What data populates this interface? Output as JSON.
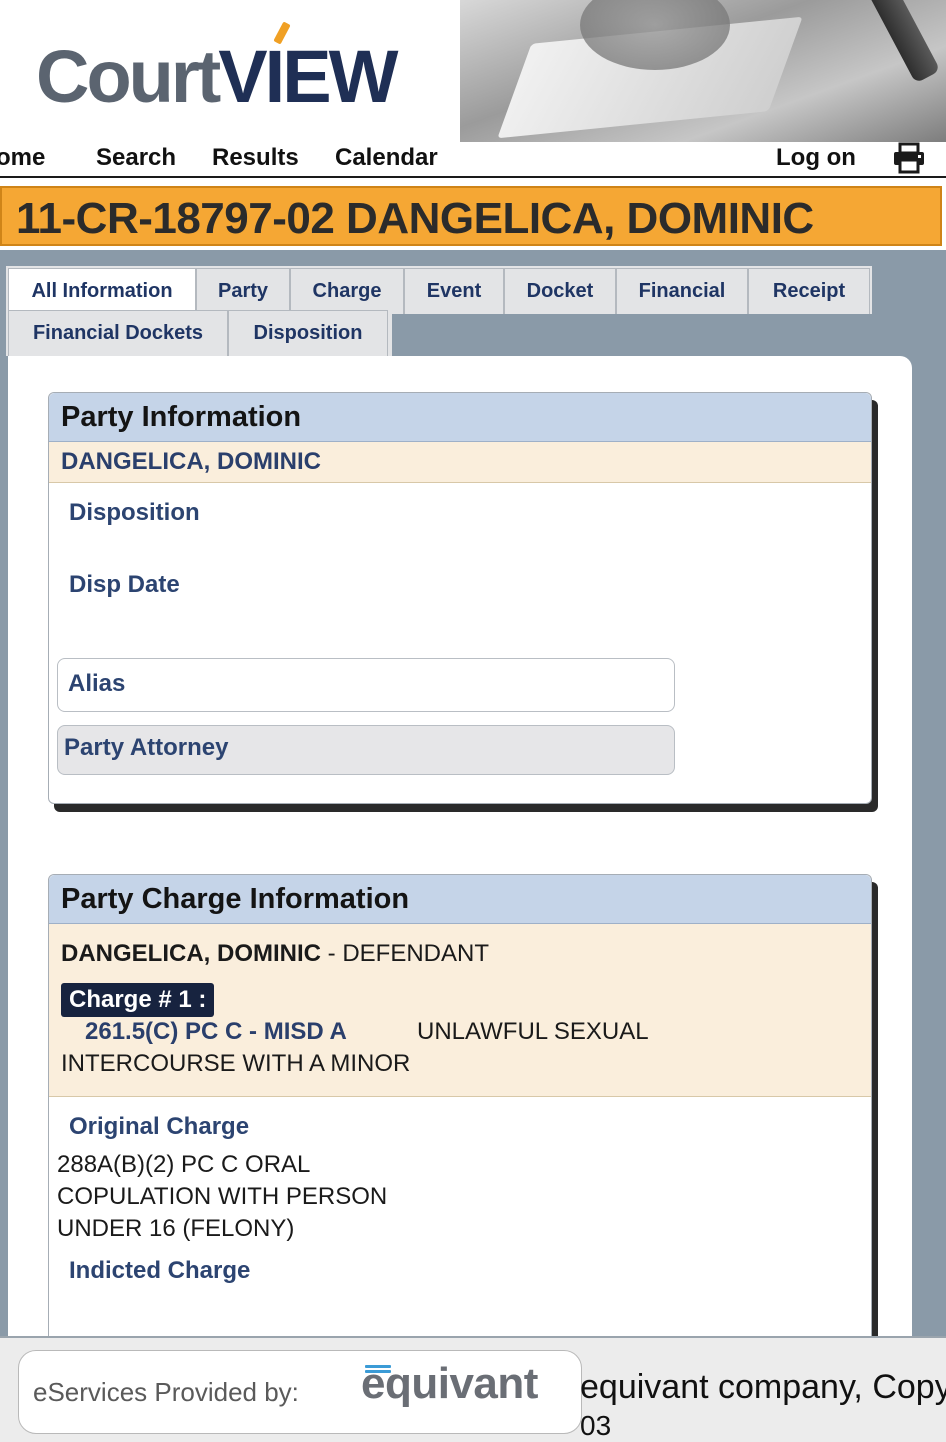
{
  "header": {
    "logo_court": "Court",
    "logo_view": "VIEW",
    "nav": [
      "ome",
      "Search",
      "Results",
      "Calendar"
    ],
    "log_on": "Log on",
    "print_icon": "printer-icon"
  },
  "case": {
    "title": "11-CR-18797-02 DANGELICA, DOMINIC"
  },
  "tabs": {
    "row1": [
      "All Information",
      "Party",
      "Charge",
      "Event",
      "Docket",
      "Financial",
      "Receipt"
    ],
    "row2": [
      "Financial Dockets",
      "Disposition"
    ],
    "active": "All Information"
  },
  "party_info": {
    "title": "Party Information",
    "party_name": "DANGELICA, DOMINIC",
    "disposition_label": "Disposition",
    "disp_date_label": "Disp Date",
    "alias_label": "Alias",
    "attorney_label": "Party Attorney"
  },
  "charge_info": {
    "title": "Party Charge Information",
    "party_name": "DANGELICA, DOMINIC",
    "party_role": " - DEFENDANT",
    "charge_badge": "Charge # 1 :",
    "charge_code": "261.5(C) PC C - MISD A",
    "charge_desc_1": "UNLAWFUL SEXUAL",
    "charge_desc_2": "INTERCOURSE WITH A MINOR",
    "original_label": "Original Charge",
    "original_lines": [
      "288A(B)(2) PC C ORAL",
      "COPULATION WITH PERSON",
      "UNDER 16 (FELONY)"
    ],
    "indicted_label": "Indicted Charge"
  },
  "footer": {
    "provided_by": "eServices Provided by:",
    "equivant": "equivant",
    "copyright": "equivant company, Copy",
    "copyright_2": "03"
  },
  "colors": {
    "case_banner": "#f5a734",
    "panel_header": "#c5d4e8",
    "label_blue": "#2c4471",
    "party_strip": "#faeedc"
  }
}
